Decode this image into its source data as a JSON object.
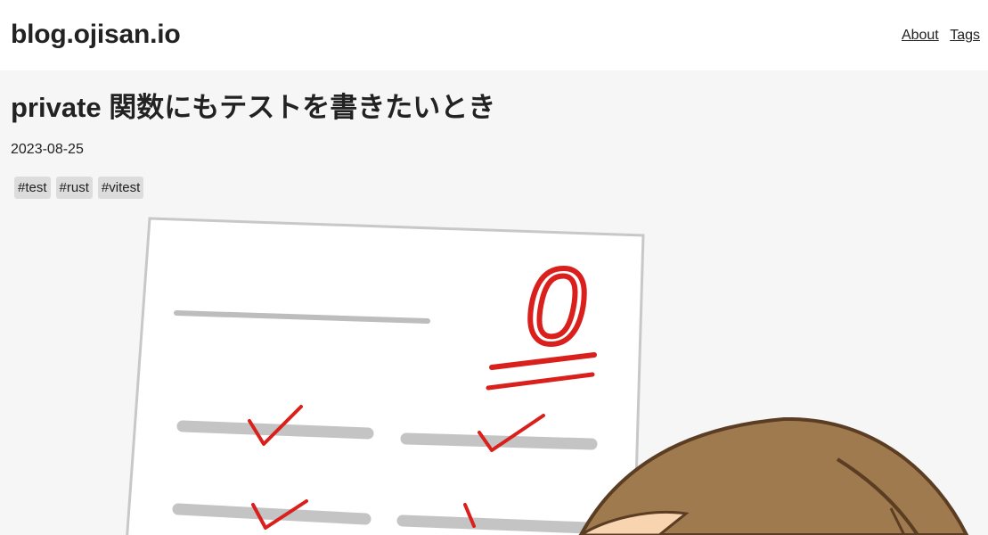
{
  "header": {
    "site_title": "blog.ojisan.io",
    "nav": [
      {
        "label": "About"
      },
      {
        "label": "Tags"
      }
    ]
  },
  "post": {
    "title": "private 関数にもテストを書きたいとき",
    "date": "2023-08-25",
    "tags": [
      "#test",
      "#rust",
      "#vitest"
    ]
  },
  "hero_image": {
    "description_icon": "test-paper-illustration",
    "score_mark": "0"
  }
}
